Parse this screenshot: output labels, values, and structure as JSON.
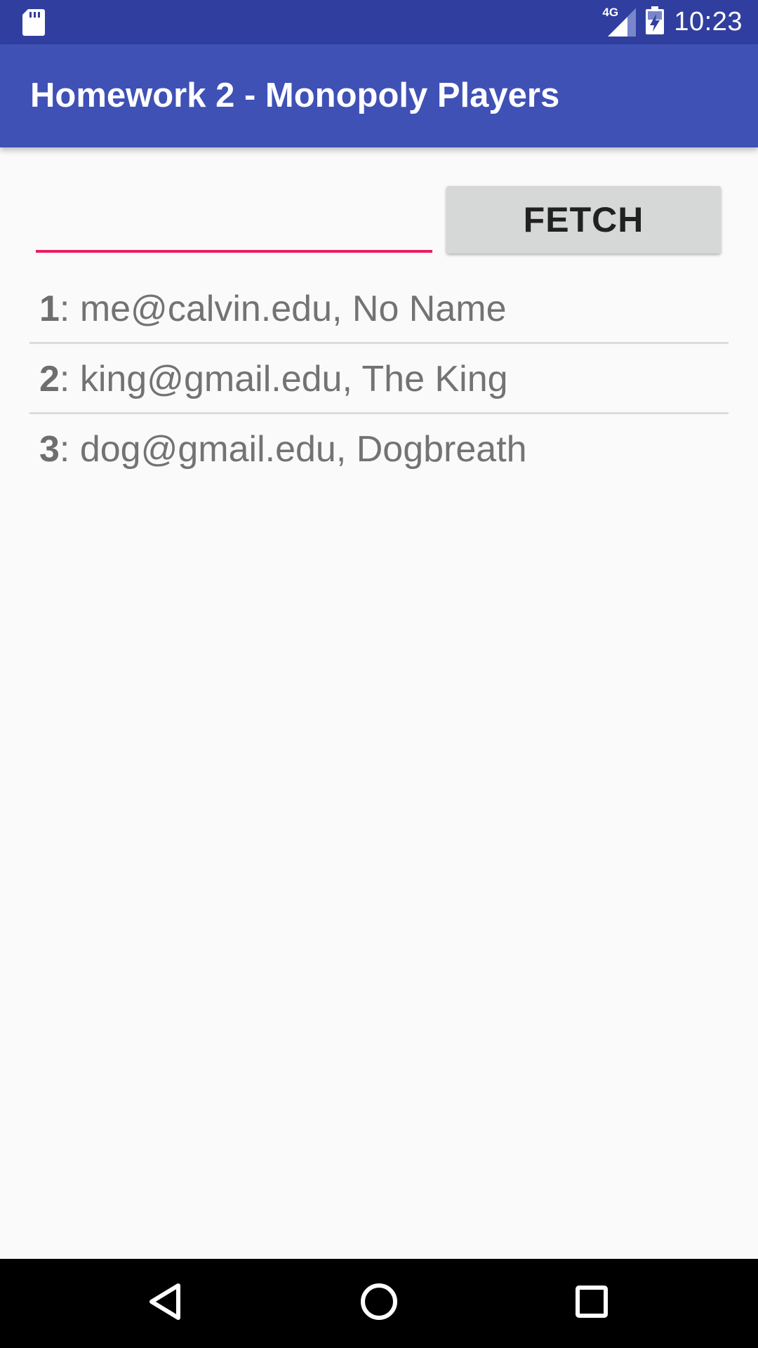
{
  "status_bar": {
    "network_label": "4G",
    "time": "10:23",
    "left_icon": "sd-card-icon",
    "icons": [
      "signal-icon",
      "battery-icon"
    ]
  },
  "app_bar": {
    "title": "Homework 2 - Monopoly Players"
  },
  "form": {
    "input_value": "",
    "input_placeholder": "",
    "fetch_label": "FETCH"
  },
  "players": [
    {
      "id": "1",
      "details": ": me@calvin.edu, No Name"
    },
    {
      "id": "2",
      "details": ": king@gmail.edu, The King"
    },
    {
      "id": "3",
      "details": ": dog@gmail.edu, Dogbreath"
    }
  ],
  "nav_bar": {
    "buttons": [
      "back-icon",
      "home-icon",
      "recents-icon"
    ]
  },
  "colors": {
    "status_bar": "#303f9f",
    "app_bar": "#3f51b5",
    "accent": "#e91e63",
    "button": "#d6d7d7",
    "background": "#fafafa"
  }
}
